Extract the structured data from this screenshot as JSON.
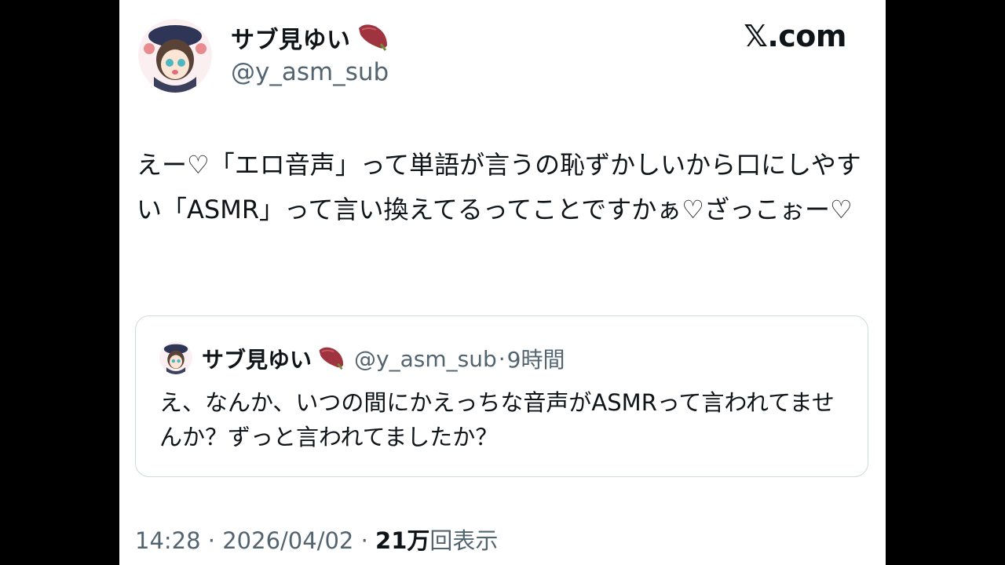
{
  "site": {
    "brand": "𝕏.com"
  },
  "tweet": {
    "display_name": "サブ見ゆい",
    "handle": "@y_asm_sub",
    "text": "えー♡「エロ音声」って単語が言うの恥ずかしいから口にしやすい「ASMR」って言い換えてるってことですかぁ♡ざっこぉー♡",
    "avatar_icon": "anime-girl-avatar-icon",
    "name_emoji_icon": "sweet-potato-icon"
  },
  "quoted": {
    "display_name": "サブ見ゆい",
    "handle": "@y_asm_sub",
    "separator": "·",
    "time": "9時間",
    "text": "え、なんか、いつの間にかえっちな音声がASMRって言われてませんか？ずっと言われてましたか？"
  },
  "meta": {
    "time": "14:28",
    "sep1": " · ",
    "date": "2026/04/02",
    "sep2": " · ",
    "views_count": "21万",
    "views_label": "回表示"
  },
  "colors": {
    "background": "#000000",
    "panel": "#ffffff",
    "text": "#0f1419",
    "muted": "#536471",
    "border": "#cfd9de"
  }
}
